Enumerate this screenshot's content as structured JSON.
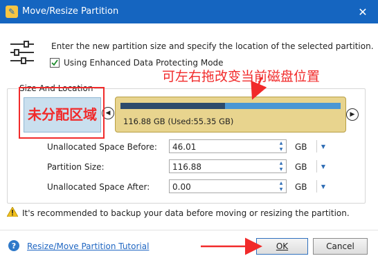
{
  "window": {
    "title": "Move/Resize Partition",
    "close_glyph": "✕"
  },
  "description": {
    "text": "Enter the new partition size and specify the location of the selected partition.",
    "checkbox_label": "Using Enhanced Data Protecting Mode",
    "checkbox_checked": true
  },
  "group": {
    "label": "Size And Location"
  },
  "partition": {
    "label": "116.88 GB (Used:55.35 GB)",
    "used_fraction": 0.474
  },
  "fields": [
    {
      "label": "Unallocated Space Before:",
      "value": "46.01",
      "unit": "GB"
    },
    {
      "label": "Partition Size:",
      "value": "116.88",
      "unit": "GB"
    },
    {
      "label": "Unallocated Space After:",
      "value": "0.00",
      "unit": "GB"
    }
  ],
  "warning": {
    "text": "It's recommended to backup your data before moving or resizing the partition."
  },
  "footer": {
    "tutorial_link": "Resize/Move Partition Tutorial",
    "ok_label": "OK",
    "cancel_label": "Cancel"
  },
  "annotations": {
    "unallocated_region": "未分配区域",
    "drag_hint": "可左右拖改变当前磁盘位置",
    "color": "#f12a2a"
  },
  "icons": {
    "app": "app-icon",
    "close": "close-icon",
    "sliders": "sliders-icon",
    "warning": "warning-icon",
    "help": "help-icon"
  }
}
